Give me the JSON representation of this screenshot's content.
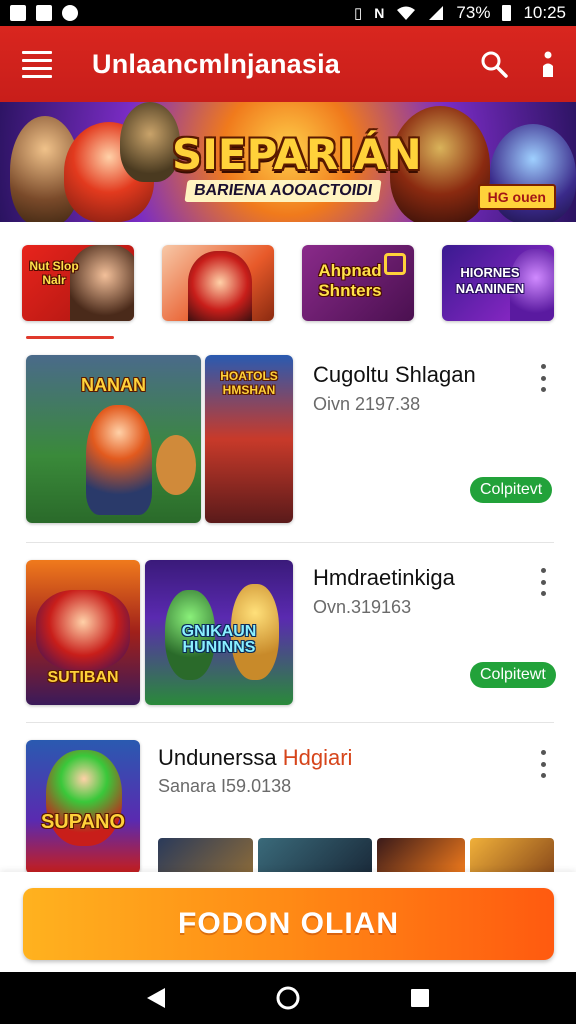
{
  "status_bar": {
    "battery": "73%",
    "time": "10:25",
    "icons": [
      "image-icon",
      "notification-icon",
      "clock-icon",
      "vibrate-icon",
      "nfc-icon",
      "wifi-icon",
      "signal-icon",
      "battery-icon"
    ]
  },
  "app_bar": {
    "title": "Unlaancmlnjanasia",
    "icons": [
      "menu-icon",
      "search-icon",
      "more-vert-icon"
    ]
  },
  "hero": {
    "title": "SIEPARIÁN",
    "subtitle": "BARIENA AOOACTOIDI",
    "badge": "HG ouen"
  },
  "categories": [
    {
      "label": "Nut Slop Nalr",
      "color": "#c81e1a"
    },
    {
      "label": "",
      "color": "#e85a2a"
    },
    {
      "label": "Ahpnad Shnters",
      "color": "#6a1f6a"
    },
    {
      "label": "HIORNES NAANINEN",
      "color": "#5a2aa0"
    }
  ],
  "items": [
    {
      "title": "Cugoltu Shlagan",
      "meta": "Oivn 2197.38",
      "chip": "Colpitevt",
      "thumb_main_text": "NANAN",
      "thumb_side_text": "HOATOLS HMSHAN"
    },
    {
      "title": "Hmdraetinkiga",
      "meta": "Ovn.319163",
      "chip": "Colpitewt",
      "thumb_main_text": "SUTIBAN",
      "thumb_side_text": "GNIKAUN HUNINNS"
    },
    {
      "title_main": "Undunerssa ",
      "title_accent": "Hdgiari",
      "meta": "Sanara I59.0138",
      "thumb_main_text": "SUPANO"
    }
  ],
  "cta": {
    "label": "FODON OLIAN"
  },
  "nav": {
    "icons": [
      "back-icon",
      "home-icon",
      "recents-icon"
    ]
  },
  "colors": {
    "brand_red": "#d9261f",
    "cta_orange": "#ff8a15",
    "chip_green": "#22a23a",
    "accent_orange": "#d6451b"
  }
}
